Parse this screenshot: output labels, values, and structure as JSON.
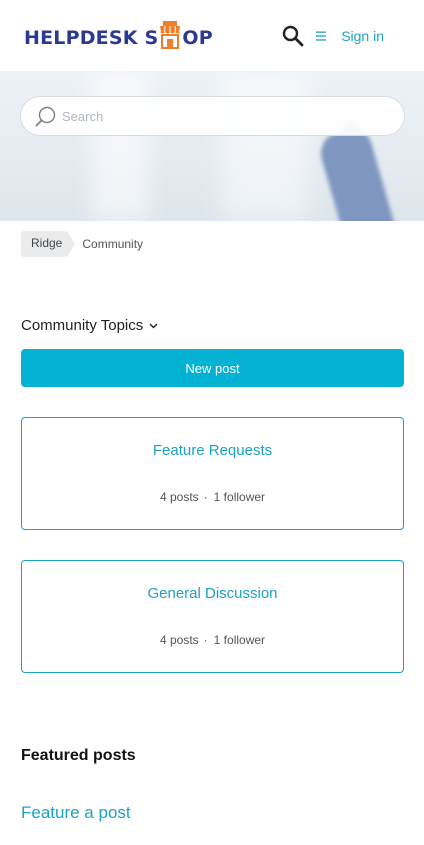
{
  "header": {
    "logo_text_start": "HELPDESK S",
    "logo_text_end": "OP",
    "sign_in": "Sign in",
    "icons": {
      "search": "search-icon",
      "menu": "hamburger-menu-icon",
      "logo": "shop-awning-icon"
    }
  },
  "hero": {
    "search_placeholder": "Search"
  },
  "breadcrumb": {
    "items": [
      "Ridge",
      "Community"
    ]
  },
  "topics": {
    "dropdown_label": "Community Topics",
    "new_post_label": "New post",
    "cards": [
      {
        "title": "Feature Requests",
        "posts": "4 posts",
        "separator": "·",
        "followers": "1 follower"
      },
      {
        "title": "General Discussion",
        "posts": "4 posts",
        "separator": "·",
        "followers": "1 follower"
      }
    ]
  },
  "featured": {
    "heading": "Featured posts",
    "link": "Feature a post"
  },
  "colors": {
    "brand_navy": "#2b3a8f",
    "brand_orange": "#f07f2c",
    "accent": "#1ca2c5",
    "button": "#04b3d3"
  }
}
